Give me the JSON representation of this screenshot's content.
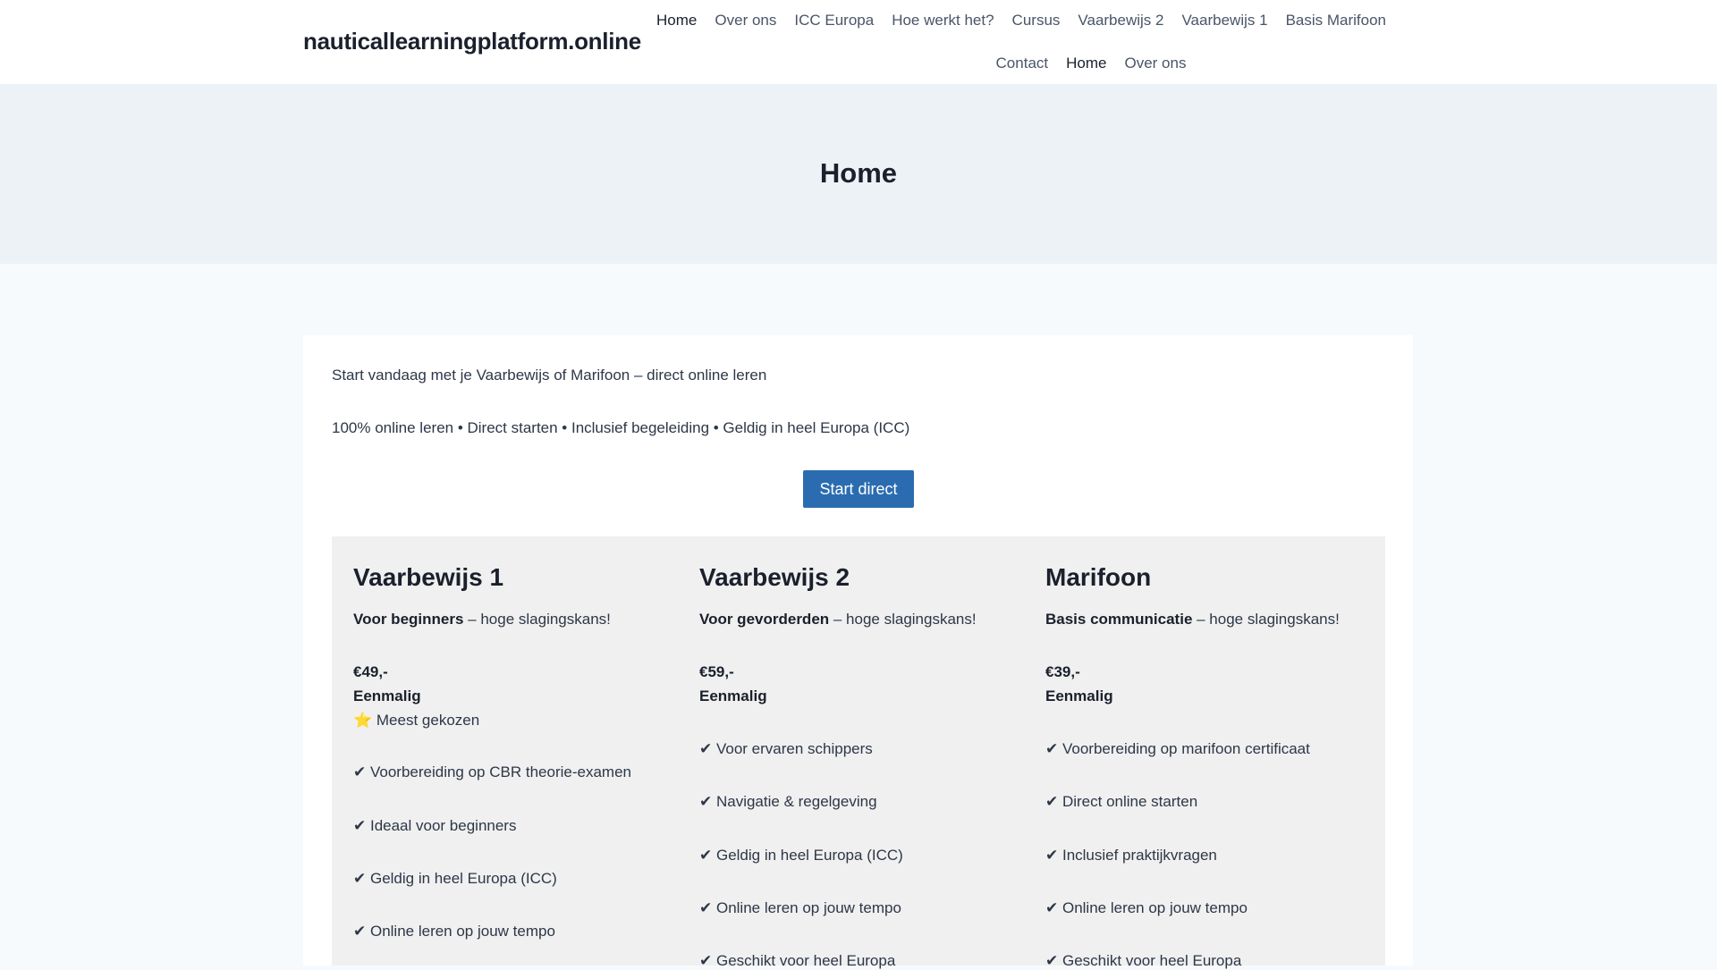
{
  "header": {
    "logo": "nauticallearningplatform.online",
    "nav_row1": [
      "Home",
      "Over ons",
      "ICC Europa",
      "Hoe werkt het?",
      "Cursus",
      "Vaarbewijs 2",
      "Vaarbewijs 1",
      "Basis Marifoon"
    ],
    "nav_row2": [
      "Contact",
      "Home",
      "Over ons"
    ]
  },
  "hero": {
    "title": "Home"
  },
  "main": {
    "intro": "Start vandaag met je Vaarbewijs of Marifoon – direct online leren",
    "features": "100% online leren • Direct starten • Inclusief begeleiding • Geldig in heel Europa (ICC)",
    "cta": "Start direct",
    "plans": [
      {
        "title": "Vaarbewijs 1",
        "tag_bold": "Voor beginners",
        "tag_rest": " – hoge slagingskans!",
        "price": "€49,-",
        "term": "Eenmalig",
        "badge": "⭐ Meest gekozen",
        "items": [
          "✔ Voorbereiding op CBR theorie-examen",
          "✔ Ideaal voor beginners",
          "✔ Geldig in heel Europa (ICC)",
          "✔ Online leren op jouw tempo"
        ]
      },
      {
        "title": "Vaarbewijs 2",
        "tag_bold": "Voor gevorderden",
        "tag_rest": " – hoge slagingskans!",
        "price": "€59,-",
        "term": "Eenmalig",
        "items": [
          "✔ Voor ervaren schippers",
          "✔ Navigatie & regelgeving",
          "✔ Geldig in heel Europa (ICC)",
          "✔ Online leren op jouw tempo",
          "✔ Geschikt voor heel Europa"
        ]
      },
      {
        "title": "Marifoon",
        "tag_bold": "Basis communicatie",
        "tag_rest": " – hoge slagingskans!",
        "price": "€39,-",
        "term": "Eenmalig",
        "items": [
          "✔ Voorbereiding op marifoon certificaat",
          "✔ Direct online starten",
          "✔ Inclusief praktijkvragen",
          "✔ Online leren op jouw tempo",
          "✔ Geschikt voor heel Europa"
        ]
      }
    ]
  }
}
